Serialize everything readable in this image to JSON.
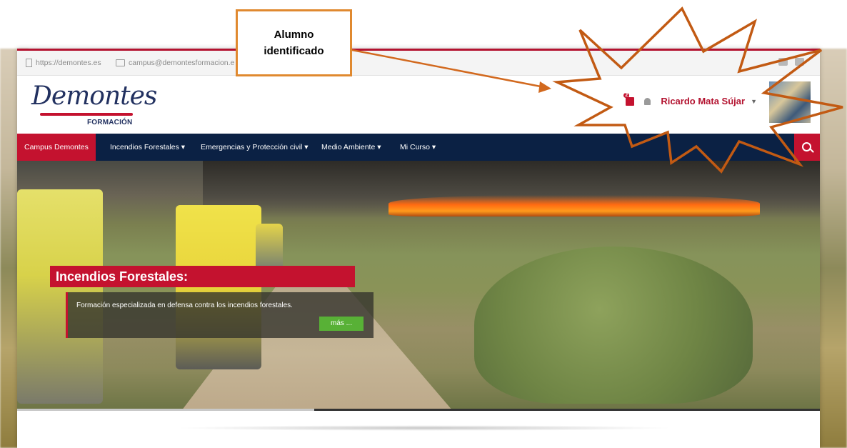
{
  "topbar": {
    "website": "https://demontes.es",
    "email": "campus@demontesformacion.e"
  },
  "logo": {
    "script": "Demontes",
    "subtitle": "FORMACIÓN"
  },
  "user": {
    "name": "Ricardo Mata Sújar",
    "message_count": "2"
  },
  "nav": {
    "items": [
      "Campus Demontes",
      "Incendios Forestales ▾",
      "Emergencias y Protección civil ▾",
      "Medio Ambiente ▾",
      "Mi Curso ▾"
    ],
    "active_index": 0
  },
  "hero": {
    "title": "Incendios Forestales:",
    "description": "Formación especializada en defensa contra los incendios forestales.",
    "more_label": "más ...",
    "slider_progress": 0.37
  },
  "annotation": {
    "callout": "Alumno\nidentificado",
    "color": "#e0892f"
  },
  "colors": {
    "accent": "#c4122f",
    "nav_bg": "#0b2144",
    "button_green": "#58b136"
  },
  "icons": [
    "page-icon",
    "mail-icon",
    "twitter-icon",
    "youtube-icon",
    "message-icon",
    "bell-icon",
    "chevron-down-icon",
    "search-icon"
  ]
}
